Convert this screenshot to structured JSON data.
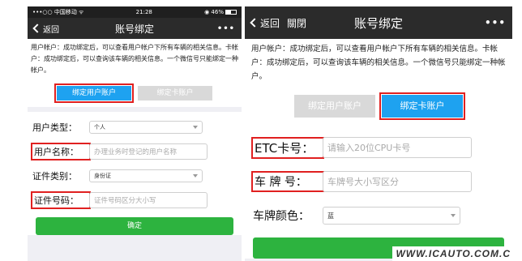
{
  "left": {
    "status": {
      "carrier": "•••○○ 中国移动 ᯤ",
      "time": "21:28",
      "battery_text": "◉ 46%"
    },
    "nav": {
      "back_label": "返回",
      "title": "账号绑定",
      "more": "•••"
    },
    "notice": "用户帐户：成功绑定后，可以查看用户帐户下所有车辆的相关信息。卡帐户：成功绑定后，可以查询该车辆的相关信息。一个微信号只能绑定一种帐户。",
    "tabs": [
      {
        "label": "绑定用户账户",
        "active": true
      },
      {
        "label": "绑定卡账户",
        "active": false
      }
    ],
    "form": {
      "user_type_label": "用户类型：",
      "user_type_value": "个人",
      "user_name_label": "用户名称：",
      "user_name_placeholder": "办理业务时登记的用户名称",
      "id_type_label": "证件类别：",
      "id_type_value": "身份证",
      "id_number_label": "证件号码：",
      "id_number_placeholder": "证件号码区分大小写",
      "submit_label": "确定"
    }
  },
  "right": {
    "nav": {
      "back_label": "返回",
      "close_label": "關閉",
      "title": "账号绑定",
      "more": "•••"
    },
    "notice": "用户帐户：成功绑定后，可以查看用户帐户下所有车辆的相关信息。卡帐户：成功绑定后，可以查询该车辆的相关信息。一个微信号只能绑定一种帐户。",
    "tabs": [
      {
        "label": "绑定用户账户",
        "active": false
      },
      {
        "label": "绑定卡账户",
        "active": true
      }
    ],
    "form": {
      "etc_label": "ETC卡号：",
      "etc_placeholder": "请输入20位CPU卡号",
      "plate_label": "车 牌 号：",
      "plate_placeholder": "车牌号大小写区分",
      "plate_color_label": "车牌颜色：",
      "plate_color_value": "蓝"
    }
  },
  "watermark": "WWW.ICAUTO.COM.C",
  "colors": {
    "accent_blue": "#1ea2f0",
    "confirm_green": "#2db33f",
    "highlight_red": "#e02020",
    "nav_dark": "#2b2b2b"
  }
}
